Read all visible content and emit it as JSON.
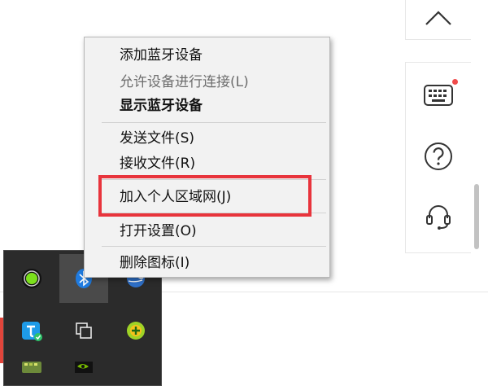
{
  "context_menu": {
    "items": [
      {
        "label": "添加蓝牙设备",
        "enabled": true,
        "bold": false
      },
      {
        "label": "允许设备进行连接(L)",
        "enabled": false,
        "bold": false
      },
      {
        "label": "显示蓝牙设备",
        "enabled": true,
        "bold": true
      },
      {
        "label": "发送文件(S)",
        "enabled": true,
        "bold": false
      },
      {
        "label": "接收文件(R)",
        "enabled": true,
        "bold": false
      },
      {
        "label": "加入个人区域网(J)",
        "enabled": true,
        "bold": false,
        "highlighted": true
      },
      {
        "label": "打开设置(O)",
        "enabled": true,
        "bold": false
      },
      {
        "label": "删除图标(I)",
        "enabled": true,
        "bold": false
      }
    ]
  },
  "side_panel": {
    "icons": [
      "chevron-up-icon",
      "keyboard-icon",
      "help-icon",
      "headset-icon"
    ],
    "notification_color": "#f04b4b"
  },
  "tray": {
    "icons": [
      "green-status-icon",
      "bluetooth-icon",
      "globe-icon",
      "tencent-app-icon",
      "copy-windows-icon",
      "green-plus-icon",
      "color-app-icon",
      "nvidia-icon"
    ]
  },
  "colors": {
    "highlight": "#e8343c",
    "menu_bg": "#f2f2f2",
    "tray_bg": "#2b2b2b"
  }
}
